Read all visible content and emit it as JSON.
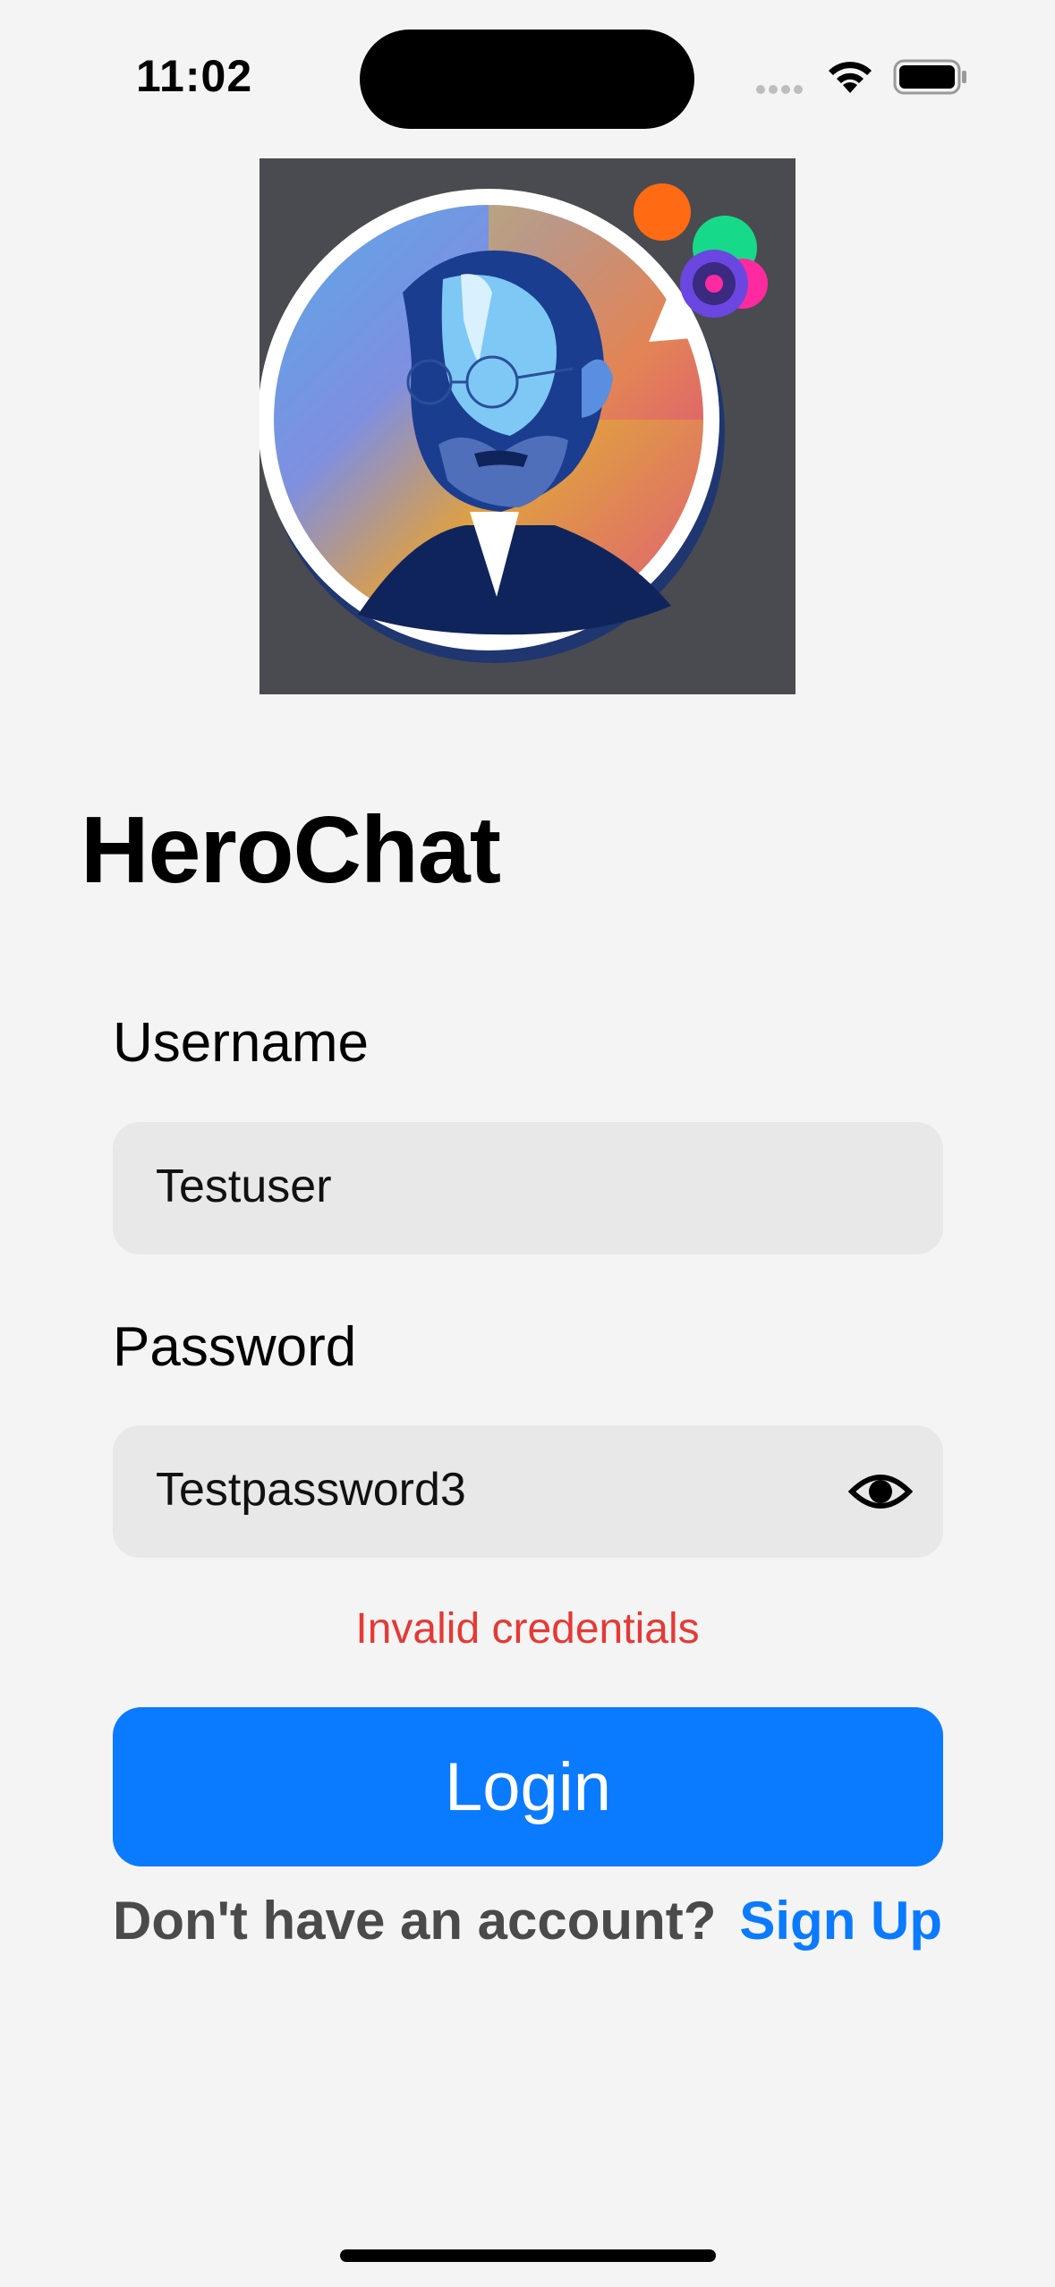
{
  "status_bar": {
    "time": "11:02"
  },
  "logo": {
    "alt": "HeroChat logo",
    "background": "#4a4b50"
  },
  "app": {
    "title": "HeroChat"
  },
  "form": {
    "username_label": "Username",
    "username_value": "Testuser",
    "password_label": "Password",
    "password_value": "Testpassword3",
    "error": "Invalid credentials",
    "login_label": "Login"
  },
  "footer": {
    "prompt": "Don't have an account?",
    "signup_label": "Sign Up"
  },
  "colors": {
    "accent": "#0a7aff",
    "error": "#e53935",
    "background": "#f4f4f4",
    "field": "#e8e8e8"
  }
}
